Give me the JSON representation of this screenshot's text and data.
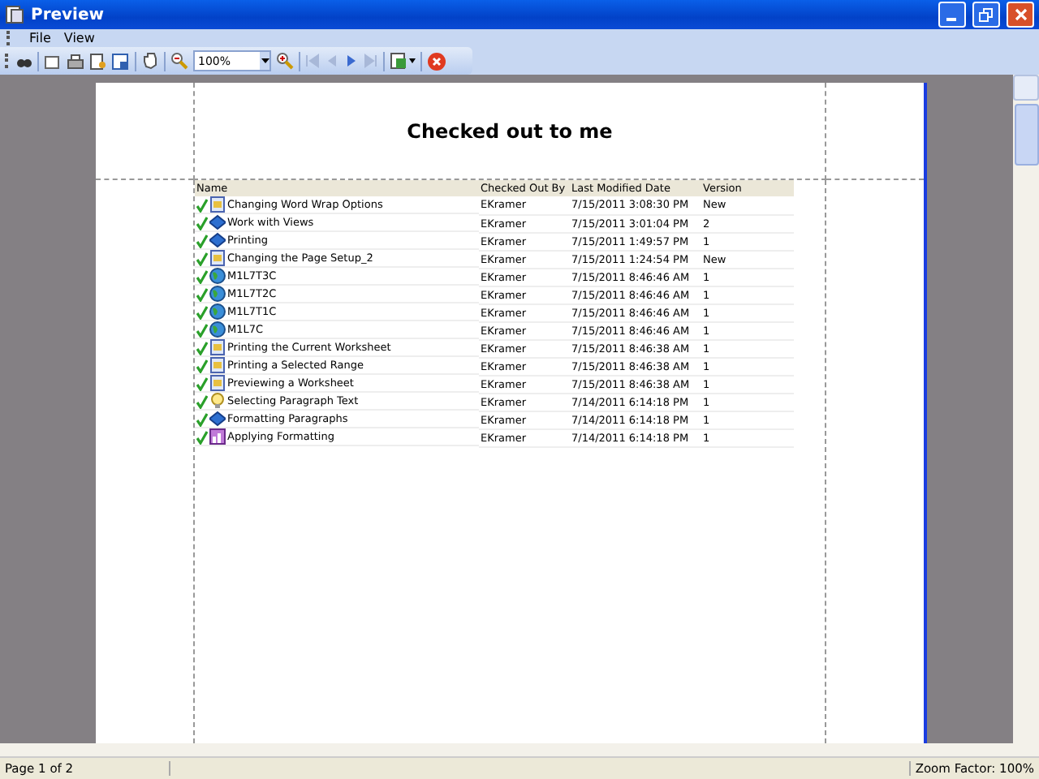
{
  "window": {
    "title": "Preview"
  },
  "menu": [
    "File",
    "View"
  ],
  "toolbar": {
    "zoom": "100%"
  },
  "report": {
    "title": "Checked out to me",
    "columns": [
      "Name",
      "Checked Out By",
      "Last Modified Date",
      "Version"
    ],
    "rows": [
      {
        "kind": "document",
        "name": "Changing Word Wrap Options",
        "by": "EKramer",
        "date": "7/15/2011 3:08:30 PM",
        "version": "New"
      },
      {
        "kind": "book",
        "name": "Work with Views",
        "by": "EKramer",
        "date": "7/15/2011 3:01:04 PM",
        "version": "2"
      },
      {
        "kind": "book",
        "name": "Printing",
        "by": "EKramer",
        "date": "7/15/2011 1:49:57 PM",
        "version": "1"
      },
      {
        "kind": "document",
        "name": "Changing the Page Setup_2",
        "by": "EKramer",
        "date": "7/15/2011 1:24:54 PM",
        "version": "New"
      },
      {
        "kind": "globe",
        "name": "M1L7T3C",
        "by": "EKramer",
        "date": "7/15/2011 8:46:46 AM",
        "version": "1"
      },
      {
        "kind": "globe",
        "name": "M1L7T2C",
        "by": "EKramer",
        "date": "7/15/2011 8:46:46 AM",
        "version": "1"
      },
      {
        "kind": "globe",
        "name": "M1L7T1C",
        "by": "EKramer",
        "date": "7/15/2011 8:46:46 AM",
        "version": "1"
      },
      {
        "kind": "globe",
        "name": "M1L7C",
        "by": "EKramer",
        "date": "7/15/2011 8:46:46 AM",
        "version": "1"
      },
      {
        "kind": "document",
        "name": "Printing the Current Worksheet",
        "by": "EKramer",
        "date": "7/15/2011 8:46:38 AM",
        "version": "1"
      },
      {
        "kind": "document",
        "name": "Printing a Selected Range",
        "by": "EKramer",
        "date": "7/15/2011 8:46:38 AM",
        "version": "1"
      },
      {
        "kind": "document",
        "name": "Previewing a Worksheet",
        "by": "EKramer",
        "date": "7/15/2011 8:46:38 AM",
        "version": "1"
      },
      {
        "kind": "bulb",
        "name": "Selecting Paragraph Text",
        "by": "EKramer",
        "date": "7/14/2011 6:14:18 PM",
        "version": "1"
      },
      {
        "kind": "book",
        "name": "Formatting Paragraphs",
        "by": "EKramer",
        "date": "7/14/2011 6:14:18 PM",
        "version": "1"
      },
      {
        "kind": "chart",
        "name": "Applying Formatting",
        "by": "EKramer",
        "date": "7/14/2011 6:14:18 PM",
        "version": "1"
      }
    ]
  },
  "status_bar": {
    "page": "Page 1 of 2",
    "zoom": "Zoom Factor: 100%"
  }
}
